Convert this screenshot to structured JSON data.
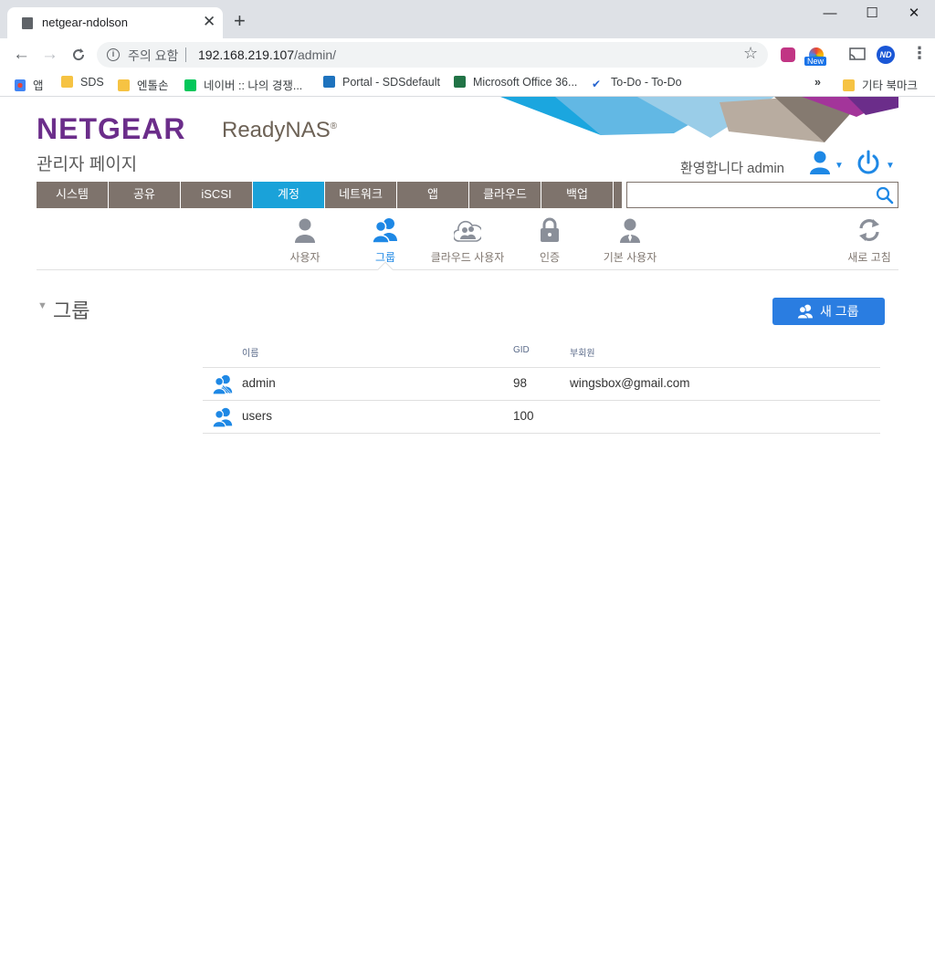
{
  "browser": {
    "tab_title": "netgear-ndolson",
    "new_tab": "+",
    "tab_close": "✕",
    "window_buttons": {
      "minimize": "—",
      "maximize": "☐",
      "close": "✕"
    },
    "security_label": "주의 요함",
    "url_host": "192.168.219.107",
    "url_path": "/admin/",
    "profile_initials": "ND",
    "ext_new_badge": "New",
    "bookmarks": {
      "apps": "앱",
      "sds": "SDS",
      "hangul_folder": "엔톨손",
      "naver": "네이버 :: 나의 경쟁...",
      "portal": "Portal - SDSdefault",
      "office": "Microsoft Office 36...",
      "todo": "To-Do - To-Do",
      "more": "»",
      "other": "기타 북마크"
    }
  },
  "header": {
    "logo": "NETGEAR",
    "product": "ReadyNAS",
    "product_mark": "®",
    "admin_page": "관리자 페이지",
    "welcome": "환영합니다 admin"
  },
  "menu": [
    "시스템",
    "공유",
    "iSCSI",
    "계정",
    "네트워크",
    "앱",
    "클라우드",
    "백업"
  ],
  "active_menu": "계정",
  "subnav": {
    "users": "사용자",
    "groups": "그룹",
    "cloud_users": "클라우드 사용자",
    "auth": "인증",
    "default_users": "기본 사용자",
    "refresh": "새로 고침"
  },
  "section": {
    "title": "그룹",
    "new_group_button": "새 그룹"
  },
  "table": {
    "headers": {
      "name": "이름",
      "gid": "GID",
      "members": "부회원"
    },
    "rows": [
      {
        "name": "admin",
        "gid": "98",
        "members": "wingsbox@gmail.com"
      },
      {
        "name": "users",
        "gid": "100",
        "members": ""
      }
    ]
  },
  "colors": {
    "brand_purple": "#6b2d8a",
    "menu_gray": "#7e736c",
    "menu_active": "#1aa2d9",
    "accent_blue": "#1e88e5",
    "button_blue": "#2a7de1"
  }
}
